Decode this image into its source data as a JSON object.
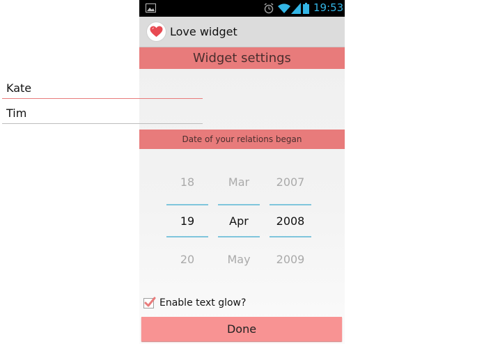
{
  "status_bar": {
    "time": "19:53",
    "icons": [
      "gallery-icon",
      "alarm-icon",
      "wifi-icon",
      "signal-icon",
      "battery-icon"
    ]
  },
  "action_bar": {
    "title": "Love widget",
    "icon": "heart-icon"
  },
  "settings": {
    "header": "Widget settings",
    "name_1": "Kate",
    "name_2": "Tim",
    "date_header": "Date of your relations began"
  },
  "date_picker": {
    "day": {
      "prev": "18",
      "selected": "19",
      "next": "20"
    },
    "month": {
      "prev": "Mar",
      "selected": "Apr",
      "next": "May"
    },
    "year": {
      "prev": "2007",
      "selected": "2008",
      "next": "2009"
    }
  },
  "glow": {
    "label": "Enable text glow?",
    "checked": true
  },
  "done_label": "Done",
  "colors": {
    "accent": "#e87b7b",
    "button": "#f89393",
    "picker_line": "#7fc5dc",
    "status_blue": "#33b5e5"
  }
}
